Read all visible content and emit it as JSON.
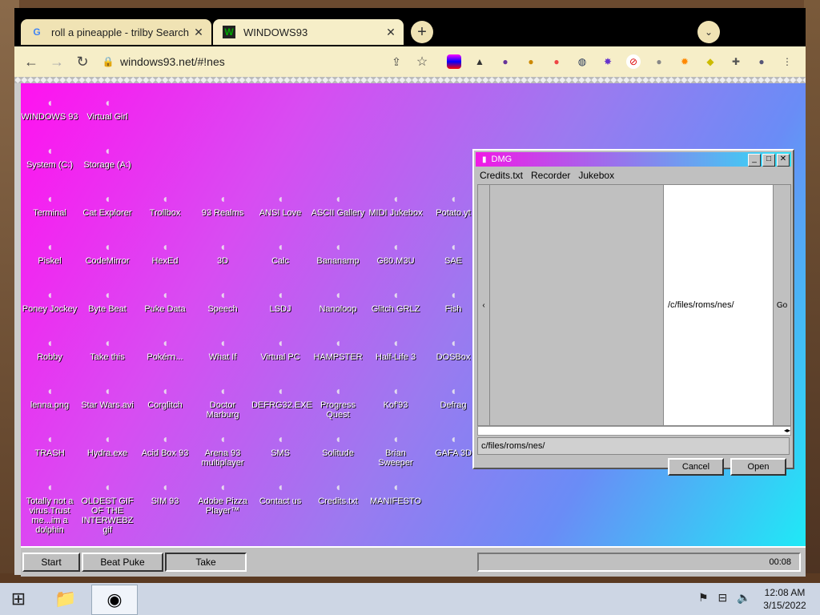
{
  "browser": {
    "tabs": [
      {
        "title": "roll a pineapple - trilby Search",
        "favicon": "G"
      },
      {
        "title": "WINDOWS93",
        "favicon": "W"
      }
    ],
    "url": "windows93.net/#!nes",
    "extensions": [
      "rainbow-ext-icon",
      "hat-ext-icon",
      "cat-ext-icon",
      "dog-ext-icon",
      "palette-ext-icon",
      "globe-ext-icon",
      "splat-ext-icon",
      "block-ext-icon",
      "alien-ext-icon",
      "burst-ext-icon",
      "bee-ext-icon",
      "puzzle-icon",
      "profile-icon",
      "menu-icon"
    ]
  },
  "desktop": {
    "icons": [
      "WINDOWS 93",
      "Virtual Girl",
      "System (C:)",
      "Storage (A:)",
      "Terminal",
      "Cat Explorer",
      "Trollbox",
      "93 Realms",
      "ANSI Love",
      "ASCII Gallery",
      "MIDI Jukebox",
      "Potato.yt",
      "Piskel",
      "CodeMirror",
      "HexEd",
      "3D",
      "Calc",
      "Bananamp",
      "G80.M3U",
      "SAE",
      "Poney Jockey",
      "Byte Beat",
      "Puke Data",
      "Speech",
      "LSDJ",
      "Nanoloop",
      "Glitch GRLZ",
      "Fish",
      "Robby",
      "Take this",
      "Pokéｍ...",
      "What If",
      "Virtual PC",
      "HAMPSTER",
      "Half-Life 3",
      "DOSBox",
      "lenna.png",
      "Star Wars.avi",
      "Corglitch",
      "Doctor Marburg",
      "DEFRG32.EXE",
      "Progress Quest",
      "Kof'93",
      "Defrag",
      "TRASH",
      "Hydra.exe",
      "Acid Box 93",
      "Arena 93 multiplayer",
      "SMS",
      "Solitude",
      "Brian Sweeper",
      "GAFA 3D",
      "Totally not a virus.Trust me...im a dolphin",
      "OLDEST GIF OF THE INTERWEBZ gif",
      "SIM 93",
      "Adobe Pizza Player™",
      "Contact us",
      "Credits.txt",
      "MANIFESTO"
    ]
  },
  "dmg": {
    "title": "DMG",
    "menu": [
      "Credits.txt",
      "Recorder",
      "Jukebox"
    ],
    "left_arrow": "‹",
    "list_path": "/c/files/roms/nes/",
    "go_label": "Go",
    "path_field": "c/files/roms/nes/",
    "cancel_label": "Cancel",
    "open_label": "Open"
  },
  "taskbar93": {
    "start_label": "Start",
    "buttons": [
      "Beat Puke",
      "Take"
    ],
    "time": "00:08"
  },
  "os": {
    "time": "12:08 AM",
    "date": "3/15/2022"
  }
}
